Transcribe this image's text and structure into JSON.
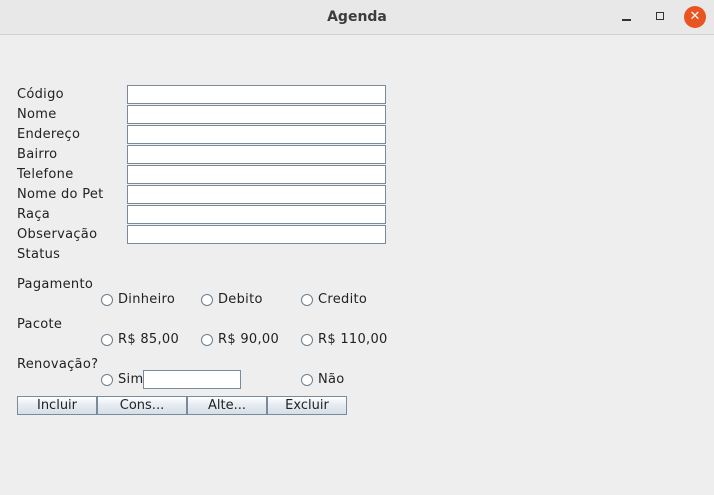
{
  "window": {
    "title": "Agenda",
    "controls": {
      "minimize": "minimize-icon",
      "maximize": "maximize-icon",
      "close": "close-icon"
    },
    "close_color": "#e95420"
  },
  "form": {
    "fields": [
      {
        "label": "Código",
        "value": ""
      },
      {
        "label": "Nome",
        "value": ""
      },
      {
        "label": "Endereço",
        "value": ""
      },
      {
        "label": "Bairro",
        "value": ""
      },
      {
        "label": "Telefone",
        "value": ""
      },
      {
        "label": "Nome do Pet",
        "value": ""
      },
      {
        "label": "Raça",
        "value": ""
      },
      {
        "label": "Observação",
        "value": ""
      }
    ],
    "status_label": "Status",
    "pagamento": {
      "label": "Pagamento",
      "options": [
        "Dinheiro",
        "Debito",
        "Credito"
      ]
    },
    "pacote": {
      "label": "Pacote",
      "options": [
        "R$ 85,00",
        "R$ 90,00",
        "R$ 110,00"
      ]
    },
    "renovacao": {
      "label": "Renovação?",
      "sim": "Sim",
      "sim_value": "",
      "nao": "Não"
    }
  },
  "buttons": [
    "Incluir",
    "Cons...",
    "Alte...",
    "Excluir"
  ]
}
